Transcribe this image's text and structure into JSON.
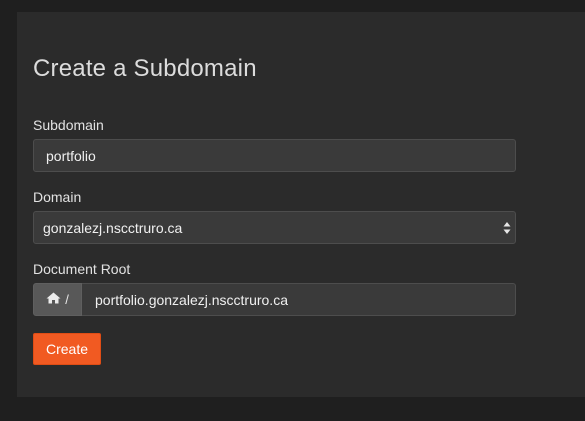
{
  "form": {
    "title": "Create a Subdomain",
    "subdomain": {
      "label": "Subdomain",
      "value": "portfolio"
    },
    "domain": {
      "label": "Domain",
      "selected": "gonzalezj.nscctruro.ca",
      "icon": "select-arrows-icon"
    },
    "document_root": {
      "label": "Document Root",
      "prefix_icon": "home-icon",
      "prefix_text": "/",
      "value": "portfolio.gonzalezj.nscctruro.ca"
    },
    "submit_label": "Create"
  },
  "colors": {
    "page_background": "#1f1f1f",
    "panel_background": "#2b2b2b",
    "input_background": "#3a3a3a",
    "accent": "#f15a22"
  }
}
